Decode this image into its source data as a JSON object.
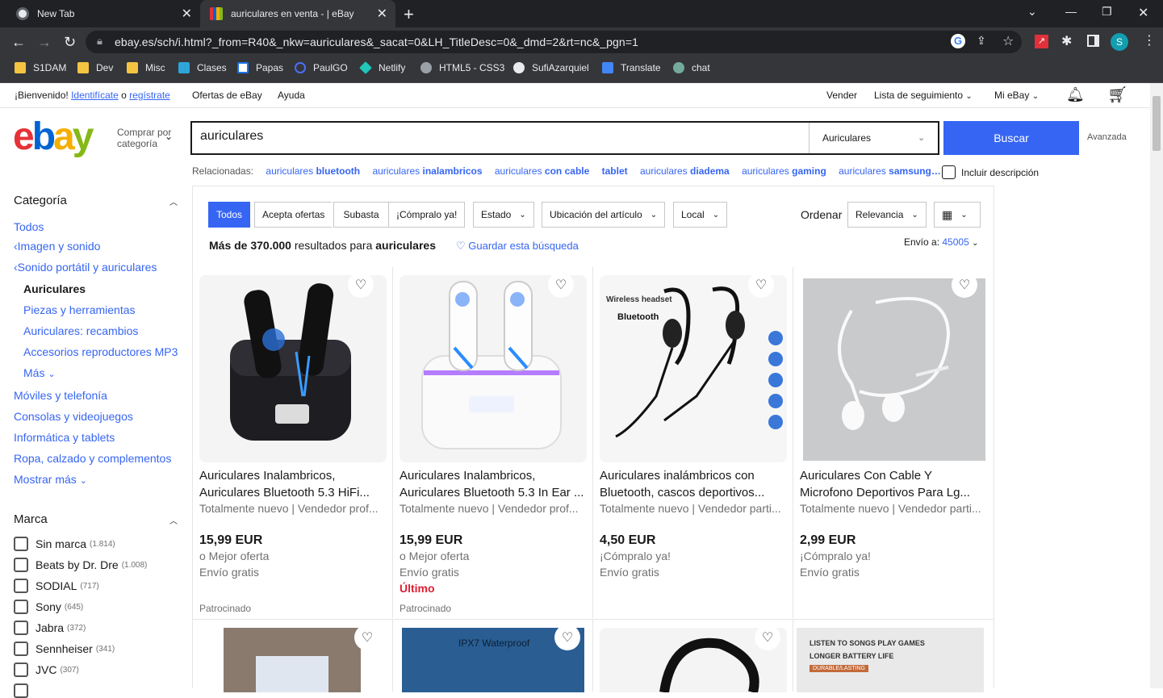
{
  "browser": {
    "tabs": [
      {
        "title": "New Tab"
      },
      {
        "title": "auriculares en venta - | eBay"
      }
    ],
    "url": "ebay.es/sch/i.html?_from=R40&_nkw=auriculares&_sacat=0&LH_TitleDesc=0&_dmd=2&rt=nc&_pgn=1",
    "profile_initial": "S",
    "bookmarks": [
      "S1DAM",
      "Dev",
      "Misc",
      "Clases",
      "Papas",
      "PaulGO",
      "Netlify",
      "HTML5 - CSS3",
      "SufiAzarquiel",
      "Translate",
      "chat"
    ]
  },
  "topbar": {
    "welcome": "¡Bienvenido!",
    "signin": "Identifícate",
    "or": "o",
    "register": "regístrate",
    "deals": "Ofertas de eBay",
    "help": "Ayuda",
    "sell": "Vender",
    "watchlist": "Lista de seguimiento",
    "myebay": "Mi eBay"
  },
  "header": {
    "shop_by": "Comprar por categoría",
    "search_value": "auriculares",
    "category_select": "Auriculares",
    "search_button": "Buscar",
    "advanced": "Avanzada"
  },
  "related": {
    "label": "Relacionadas:",
    "items": [
      {
        "a": "auriculares",
        "b": "bluetooth"
      },
      {
        "a": "auriculares",
        "b": "inalambricos"
      },
      {
        "a": "auriculares",
        "b": "con cable"
      },
      {
        "a": "",
        "b": "tablet"
      },
      {
        "a": "auriculares",
        "b": "diadema"
      },
      {
        "a": "auriculares",
        "b": "gaming"
      },
      {
        "a": "auriculares",
        "b": "samsung…"
      }
    ],
    "include_desc": "Incluir descripción"
  },
  "sidebar": {
    "category_title": "Categoría",
    "categories": {
      "all": "Todos",
      "parent1": "Imagen y sonido",
      "parent2": "Sonido portátil y auriculares",
      "current": "Auriculares",
      "children": [
        "Piezas y herramientas",
        "Auriculares: recambios",
        "Accesorios reproductores MP3"
      ],
      "more": "Más",
      "others": [
        "Móviles y telefonía",
        "Consolas y videojuegos",
        "Informática y tablets",
        "Ropa, calzado y complementos"
      ],
      "show_more": "Mostrar más"
    },
    "brand_title": "Marca",
    "brands": [
      {
        "name": "Sin marca",
        "count": "(1.814)"
      },
      {
        "name": "Beats by Dr. Dre",
        "count": "(1.008)"
      },
      {
        "name": "SODIAL",
        "count": "(717)"
      },
      {
        "name": "Sony",
        "count": "(645)"
      },
      {
        "name": "Jabra",
        "count": "(372)"
      },
      {
        "name": "Sennheiser",
        "count": "(341)"
      },
      {
        "name": "JVC",
        "count": "(307)"
      }
    ]
  },
  "filters": {
    "buttons": [
      "Todos",
      "Acepta ofertas",
      "Subasta",
      "¡Cómpralo ya!"
    ],
    "dropdowns": [
      "Estado",
      "Ubicación del artículo",
      "Local"
    ],
    "sort_label": "Ordenar",
    "sort_value": "Relevancia",
    "results_count": "Más de 370.000",
    "results_for": "resultados para",
    "results_query": "auriculares",
    "save_search": "Guardar esta búsqueda",
    "ship_to_label": "Envío a:",
    "ship_to_zip": "45005"
  },
  "products": [
    {
      "title": "Auriculares Inalambricos, Auriculares Bluetooth 5.3 HiFi...",
      "subtitle": "Totalmente nuevo | Vendedor prof...",
      "price": "15,99 EUR",
      "line1": "o Mejor oferta",
      "line2": "Envío gratis",
      "line3": "",
      "sponsored": "Patrocinado"
    },
    {
      "title": "Auriculares Inalambricos, Auriculares Bluetooth 5.3 In Ear ...",
      "subtitle": "Totalmente nuevo | Vendedor prof...",
      "price": "15,99 EUR",
      "line1": "o Mejor oferta",
      "line2": "Envío gratis",
      "line3": "Último",
      "sponsored": "Patrocinado"
    },
    {
      "title": "Auriculares inalámbricos con Bluetooth, cascos deportivos...",
      "subtitle": "Totalmente nuevo | Vendedor parti...",
      "price": "4,50 EUR",
      "line1": "¡Cómpralo ya!",
      "line2": "Envío gratis",
      "line3": "",
      "sponsored": "",
      "image_text1": "Wireless headset",
      "image_text2": "Bluetooth"
    },
    {
      "title": "Auriculares Con Cable Y Microfono Deportivos Para Lg...",
      "subtitle": "Totalmente nuevo | Vendedor parti...",
      "price": "2,99 EUR",
      "line1": "¡Cómpralo ya!",
      "line2": "Envío gratis",
      "line3": "",
      "sponsored": ""
    }
  ],
  "products_row2_image_text": {
    "p2": "IPX7 Waterproof",
    "p4a": "LISTEN TO SONGS PLAY GAMES",
    "p4b": "LONGER BATTERY LIFE",
    "p4c": "DURABLE/LASTING"
  },
  "colors": {
    "accent": "#3665f3",
    "chrome_bg": "#202124",
    "toolbar_bg": "#35363a",
    "alert": "#dd1e31"
  }
}
